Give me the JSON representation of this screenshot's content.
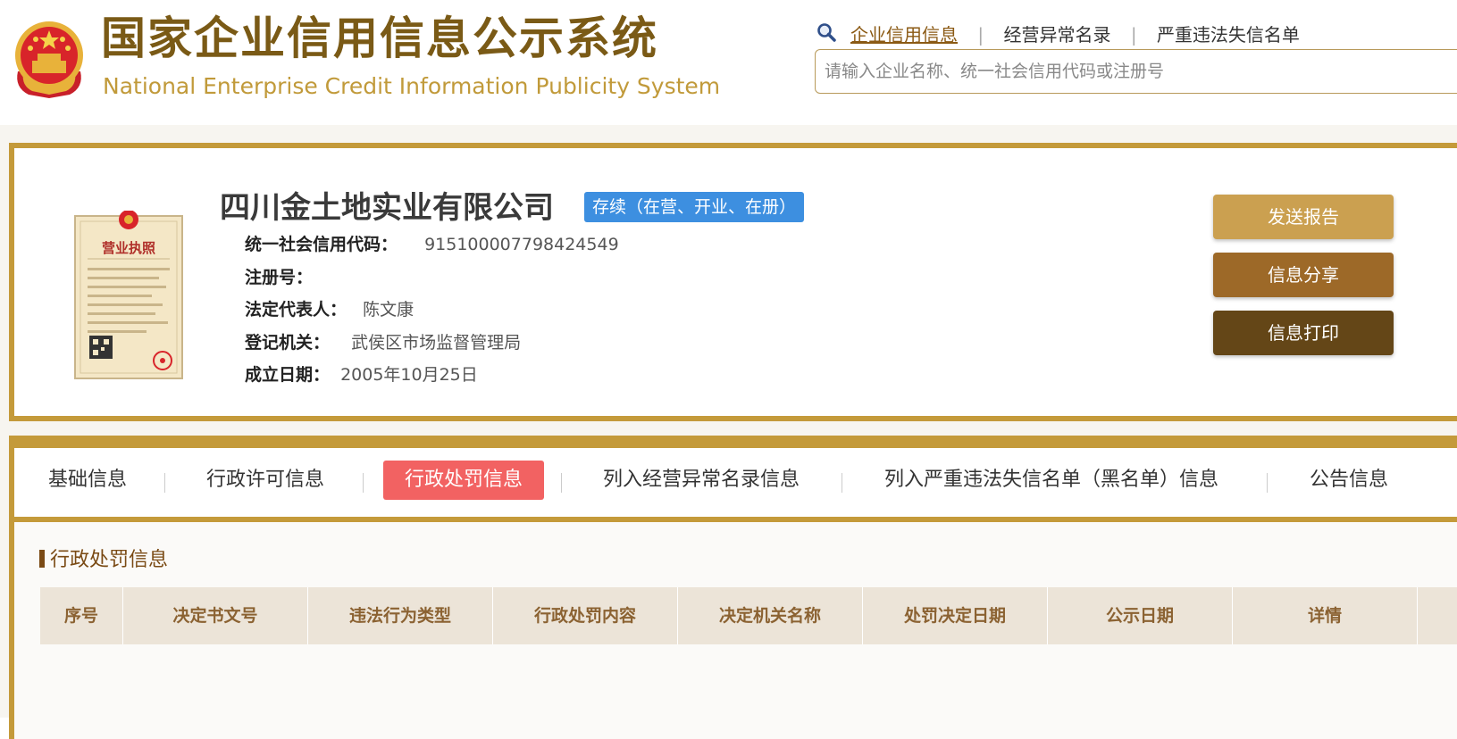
{
  "header": {
    "title_cn": "国家企业信用信息公示系统",
    "title_en": "National Enterprise Credit Information Publicity System",
    "nav": [
      {
        "label": "企业信用信息",
        "active": true
      },
      {
        "label": "经营异常名录",
        "active": false
      },
      {
        "label": "严重违法失信名单",
        "active": false
      }
    ],
    "search_placeholder": "请输入企业名称、统一社会信用代码或注册号",
    "search_value": ""
  },
  "company": {
    "name": "四川金土地实业有限公司",
    "status": "存续（在营、开业、在册）",
    "license_title": "营业执照",
    "fields": [
      {
        "label": "统一社会信用代码：",
        "value": "915100007798424549"
      },
      {
        "label": "注册号：",
        "value": ""
      },
      {
        "label": "法定代表人：",
        "value": "陈文康"
      },
      {
        "label": "登记机关：",
        "value": "武侯区市场监督管理局"
      },
      {
        "label": "成立日期：",
        "value": "2005年10月25日"
      }
    ],
    "actions": [
      "发送报告",
      "信息分享",
      "信息打印"
    ]
  },
  "tabs": [
    {
      "label": "基础信息",
      "active": false
    },
    {
      "label": "行政许可信息",
      "active": false
    },
    {
      "label": "行政处罚信息",
      "active": true
    },
    {
      "label": "列入经营异常名录信息",
      "active": false
    },
    {
      "label": "列入严重违法失信名单（黑名单）信息",
      "active": false
    },
    {
      "label": "公告信息",
      "active": false
    }
  ],
  "section": {
    "title": "行政处罚信息",
    "columns": [
      "序号",
      "决定书文号",
      "违法行为类型",
      "行政处罚内容",
      "决定机关名称",
      "处罚决定日期",
      "公示日期",
      "详情"
    ]
  },
  "colors": {
    "brand_brown": "#7a5a16",
    "gold_border": "#c49a3a",
    "active_tab": "#f26262",
    "status_blue": "#3d8fe0",
    "header_cell_bg": "#ece4d8"
  }
}
